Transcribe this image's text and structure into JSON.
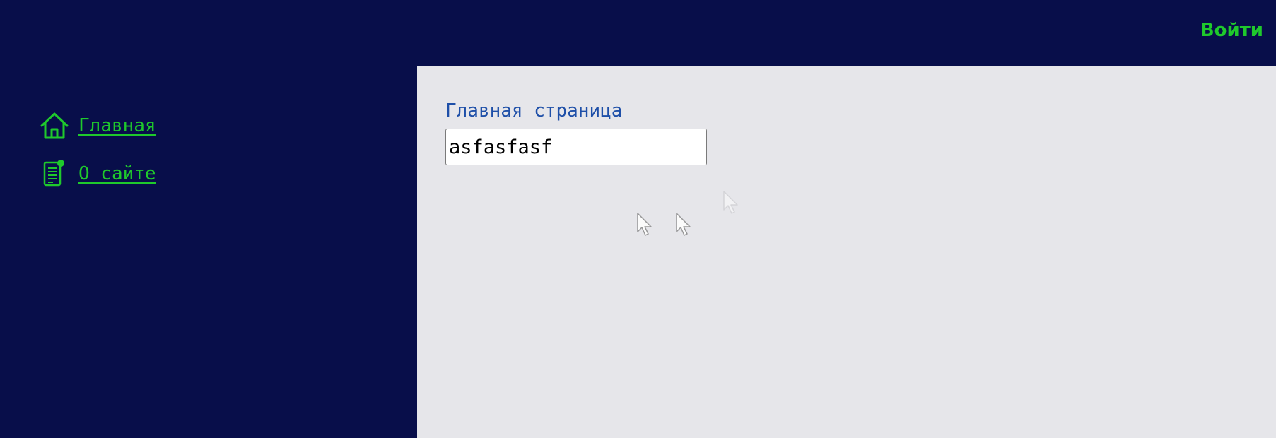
{
  "header": {
    "login_label": "Войти"
  },
  "sidebar": {
    "items": [
      {
        "label": "Главная",
        "icon": "home-icon"
      },
      {
        "label": "О сайте",
        "icon": "document-icon"
      }
    ]
  },
  "main": {
    "title": "Главная страница",
    "input": {
      "value": "asfasfasf",
      "placeholder": ""
    }
  },
  "colors": {
    "background": "#080e4a",
    "accent": "#1fc92c",
    "content_bg": "#e6e6ea",
    "title": "#1e4fa8"
  }
}
